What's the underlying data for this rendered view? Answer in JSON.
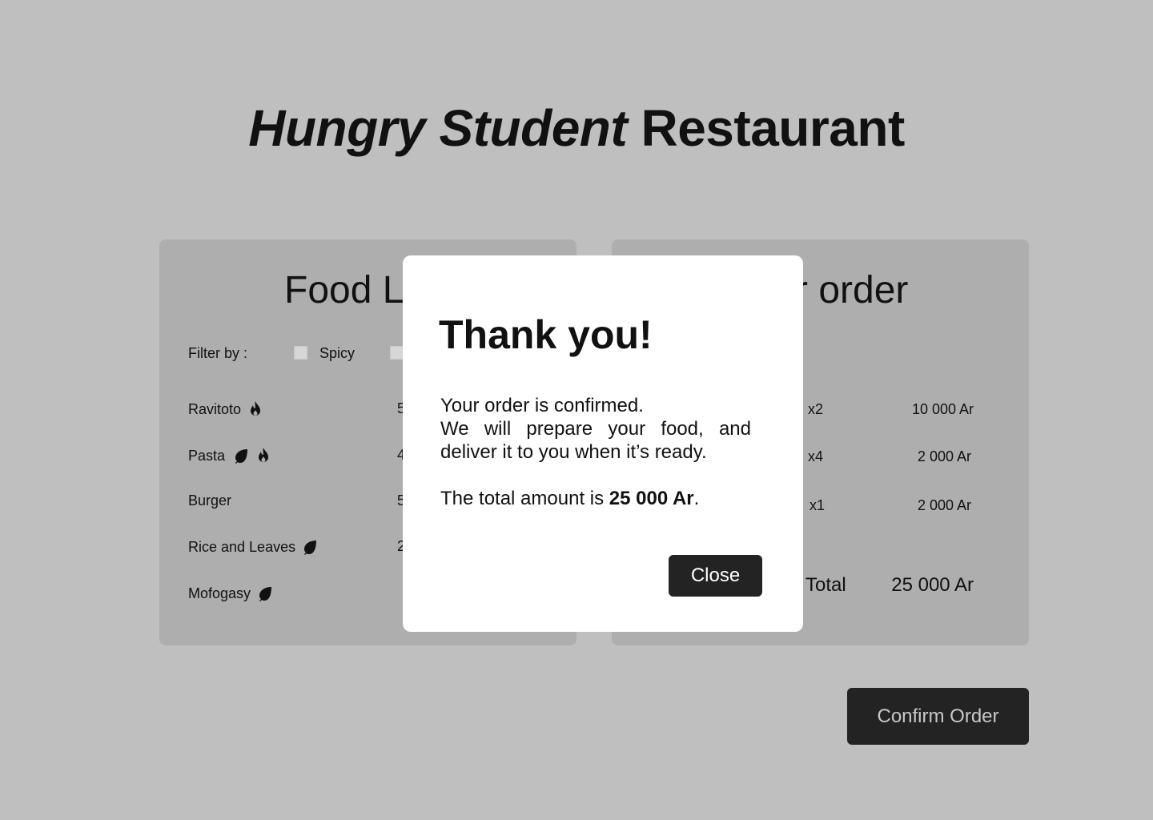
{
  "header": {
    "title_italic": "Hungry Student",
    "title_regular": "Restaurant"
  },
  "food_list": {
    "title": "Food L",
    "filter_label": "Filter by :",
    "filters": [
      {
        "label": "Spicy",
        "checked": false
      },
      {
        "label": "",
        "checked": false
      }
    ],
    "items": [
      {
        "name": "Ravitoto",
        "icons": [
          "fire-icon"
        ],
        "price": "5"
      },
      {
        "name": "Pasta",
        "icons": [
          "leaf-icon",
          "fire-icon"
        ],
        "price": "4"
      },
      {
        "name": "Burger",
        "icons": [],
        "price": "5"
      },
      {
        "name": "Rice and Leaves",
        "icons": [
          "leaf-icon"
        ],
        "price": "2"
      },
      {
        "name": "Mofogasy",
        "icons": [
          "leaf-icon"
        ],
        "price": ""
      }
    ]
  },
  "order": {
    "title": "r order",
    "items": [
      {
        "qty": "x2",
        "price": "10 000 Ar"
      },
      {
        "qty": "x4",
        "price": "2 000 Ar"
      },
      {
        "qty": "x1",
        "price": "2 000 Ar"
      }
    ],
    "total_label": "Total",
    "total_value": "25 000 Ar"
  },
  "confirm_label": "Confirm Order",
  "modal": {
    "title": "Thank you!",
    "line1": "Your order is confirmed.",
    "line2": "We will prepare your food, and deliver it to you when it’s ready.",
    "total_prefix": "The total amount is ",
    "total_amount": "25 000 Ar",
    "total_suffix": ".",
    "close_label": "Close"
  },
  "colors": {
    "background": "#bfbfbf",
    "panel": "#aeaeae",
    "button": "#232323",
    "modal": "#ffffff"
  }
}
